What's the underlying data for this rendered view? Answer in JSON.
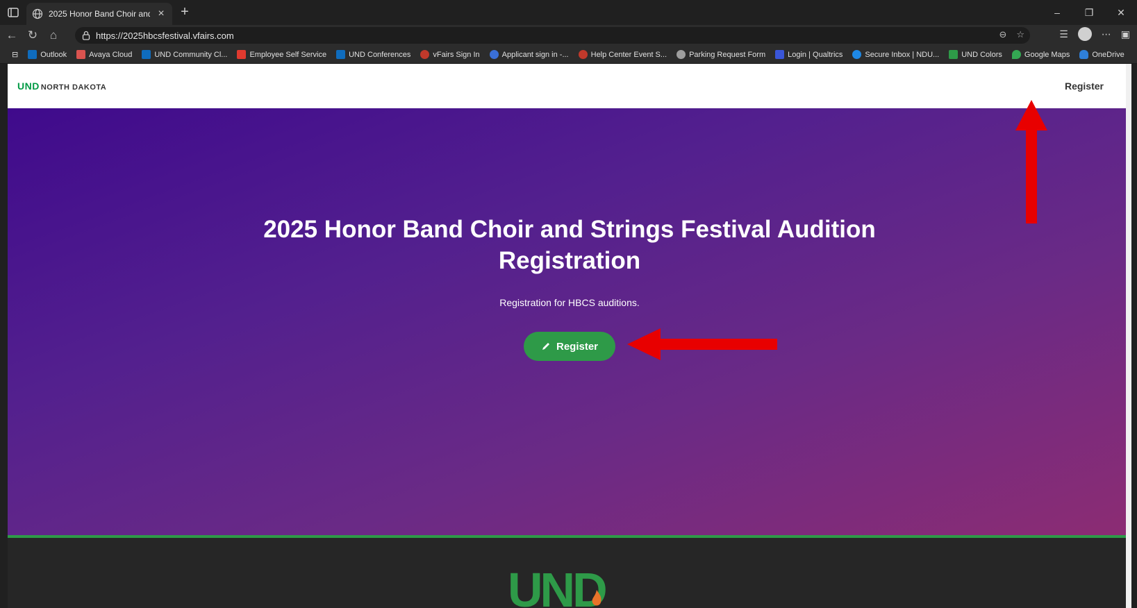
{
  "browser": {
    "tab_title": "2025 Honor Band Choir and Strin",
    "tab_close": "×",
    "new_tab": "+",
    "url": "https://2025hbcsfestival.vfairs.com",
    "window_controls": [
      "–",
      "❐",
      "✕"
    ]
  },
  "bookmarks": [
    {
      "label": "Outlook",
      "color": "#0f6cbd"
    },
    {
      "label": "Avaya Cloud",
      "color": "#d9534f"
    },
    {
      "label": "UND Community Cl...",
      "color": "#0f6cbd"
    },
    {
      "label": "Employee Self Service",
      "color": "#e03a2f"
    },
    {
      "label": "UND Conferences",
      "color": "#0f6cbd"
    },
    {
      "label": "vFairs Sign In",
      "color": "#c0392b"
    },
    {
      "label": "Applicant sign in -...",
      "color": "#3a6fd8"
    },
    {
      "label": "Help Center Event S...",
      "color": "#c0392b"
    },
    {
      "label": "Parking Request Form",
      "color": "#9e9e9e"
    },
    {
      "label": "Login | Qualtrics",
      "color": "#3a56d8"
    },
    {
      "label": "Secure Inbox | NDU...",
      "color": "#1e88e5"
    },
    {
      "label": "UND Colors",
      "color": "#2e9a48"
    },
    {
      "label": "Google Maps",
      "color": "#34a853"
    },
    {
      "label": "OneDrive",
      "color": "#2f7fd8"
    }
  ],
  "site": {
    "logo_und": "UND",
    "logo_nd": "NORTH DAKOTA",
    "nav_register": "Register",
    "hero_title": "2025 Honor Band Choir and Strings Festival Audition Registration",
    "hero_subtitle": "Registration for HBCS auditions.",
    "hero_button": "Register",
    "footer_logo": "UND"
  },
  "colors": {
    "accent_green": "#2e9a48",
    "arrow_red": "#e80000"
  }
}
